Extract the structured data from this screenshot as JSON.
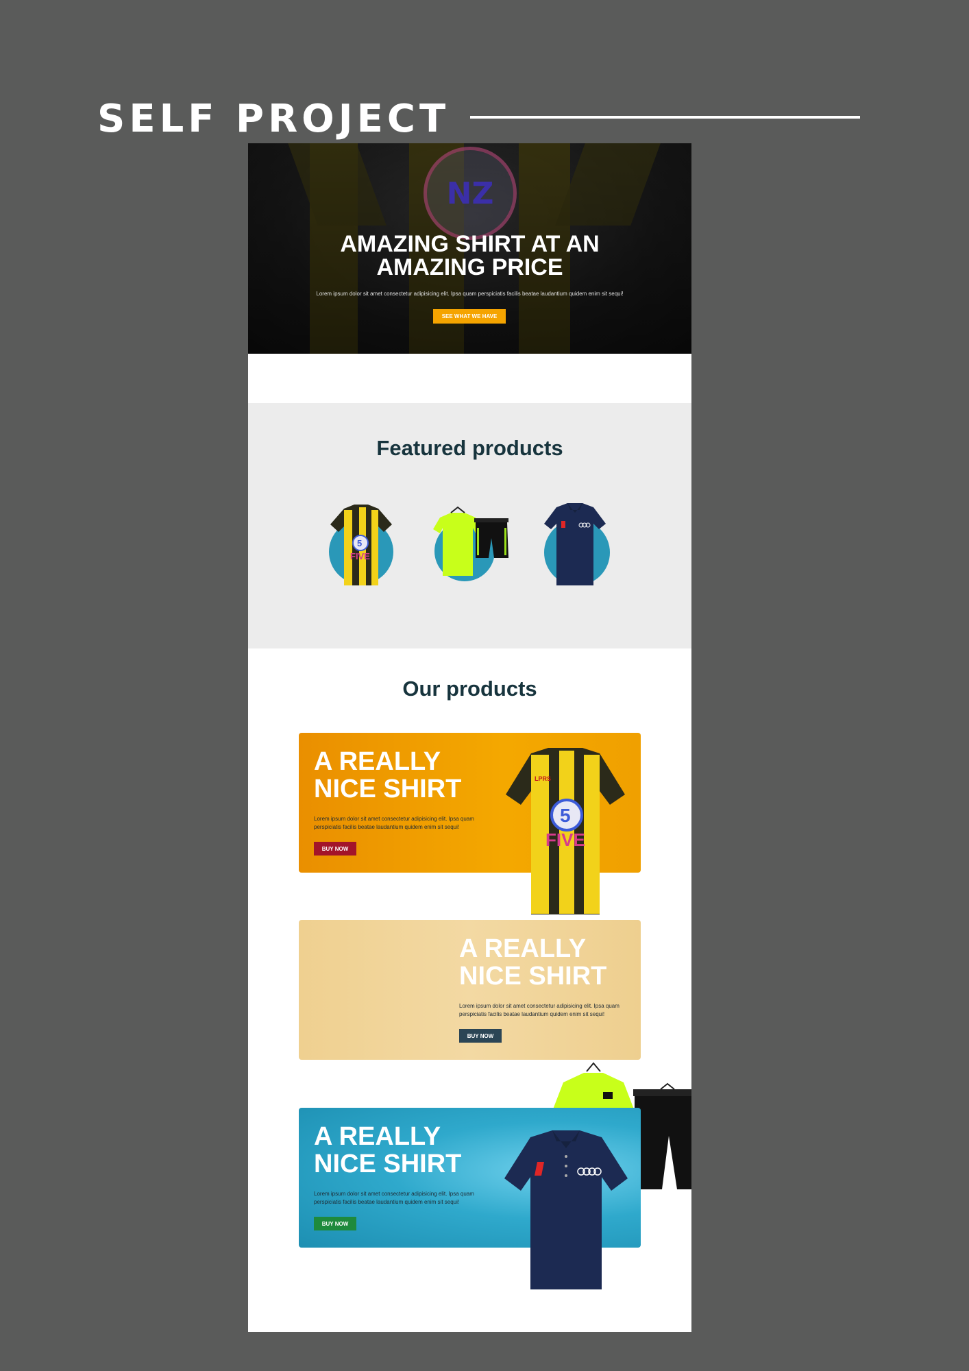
{
  "header": {
    "title": "SELF PROJECT"
  },
  "hero": {
    "logo_text": "NZ",
    "headline_line1": "AMAZING SHIRT AT AN",
    "headline_line2": "AMAZING PRICE",
    "description": "Lorem ipsum dolor sit amet consectetur adipisicing elit. Ipsa quam perspiciatis facilis beatae laudantium quidem enim sit sequi!",
    "cta_label": "SEE WHAT WE HAVE"
  },
  "featured": {
    "title": "Featured products",
    "items": [
      {
        "icon": "yellow-black-striped-jersey"
      },
      {
        "icon": "neon-green-tshirt-and-shorts-set"
      },
      {
        "icon": "navy-polo-shirt"
      }
    ]
  },
  "our_products": {
    "title": "Our products",
    "banners": [
      {
        "title_line1": "A REALLY",
        "title_line2": "NICE SHIRT",
        "text_line1": "Lorem ipsum dolor sit amet consectetur adipisicing elit. Ipsa quam",
        "text_line2": "perspiciatis facilis beatae laudantium quidem enim sit sequi!",
        "button": "BUY NOW",
        "button_color": "#a3142a",
        "background": "#f2a200"
      },
      {
        "title_line1": "A REALLY",
        "title_line2": "NICE SHIRT",
        "text_line1": "Lorem ipsum dolor sit amet consectetur adipisicing elit. Ipsa quam",
        "text_line2": "perspiciatis facilis beatae laudantium quidem enim sit sequi!",
        "button": "BUY NOW",
        "button_color": "#2b4555",
        "background": "#f2d59a"
      },
      {
        "title_line1": "A REALLY",
        "title_line2": "NICE SHIRT",
        "text_line1": "Lorem ipsum dolor sit amet consectetur adipisicing elit. Ipsa quam",
        "text_line2": "perspiciatis facilis beatae laudantium quidem enim sit sequi!",
        "button": "BUY NOW",
        "button_color": "#1e8a3c",
        "background": "#2fa9cc"
      }
    ]
  },
  "colors": {
    "page_bg": "#5a5b5a",
    "heading": "#17343d",
    "accent_orange": "#f5a400",
    "circle_teal": "#2a98b8"
  }
}
